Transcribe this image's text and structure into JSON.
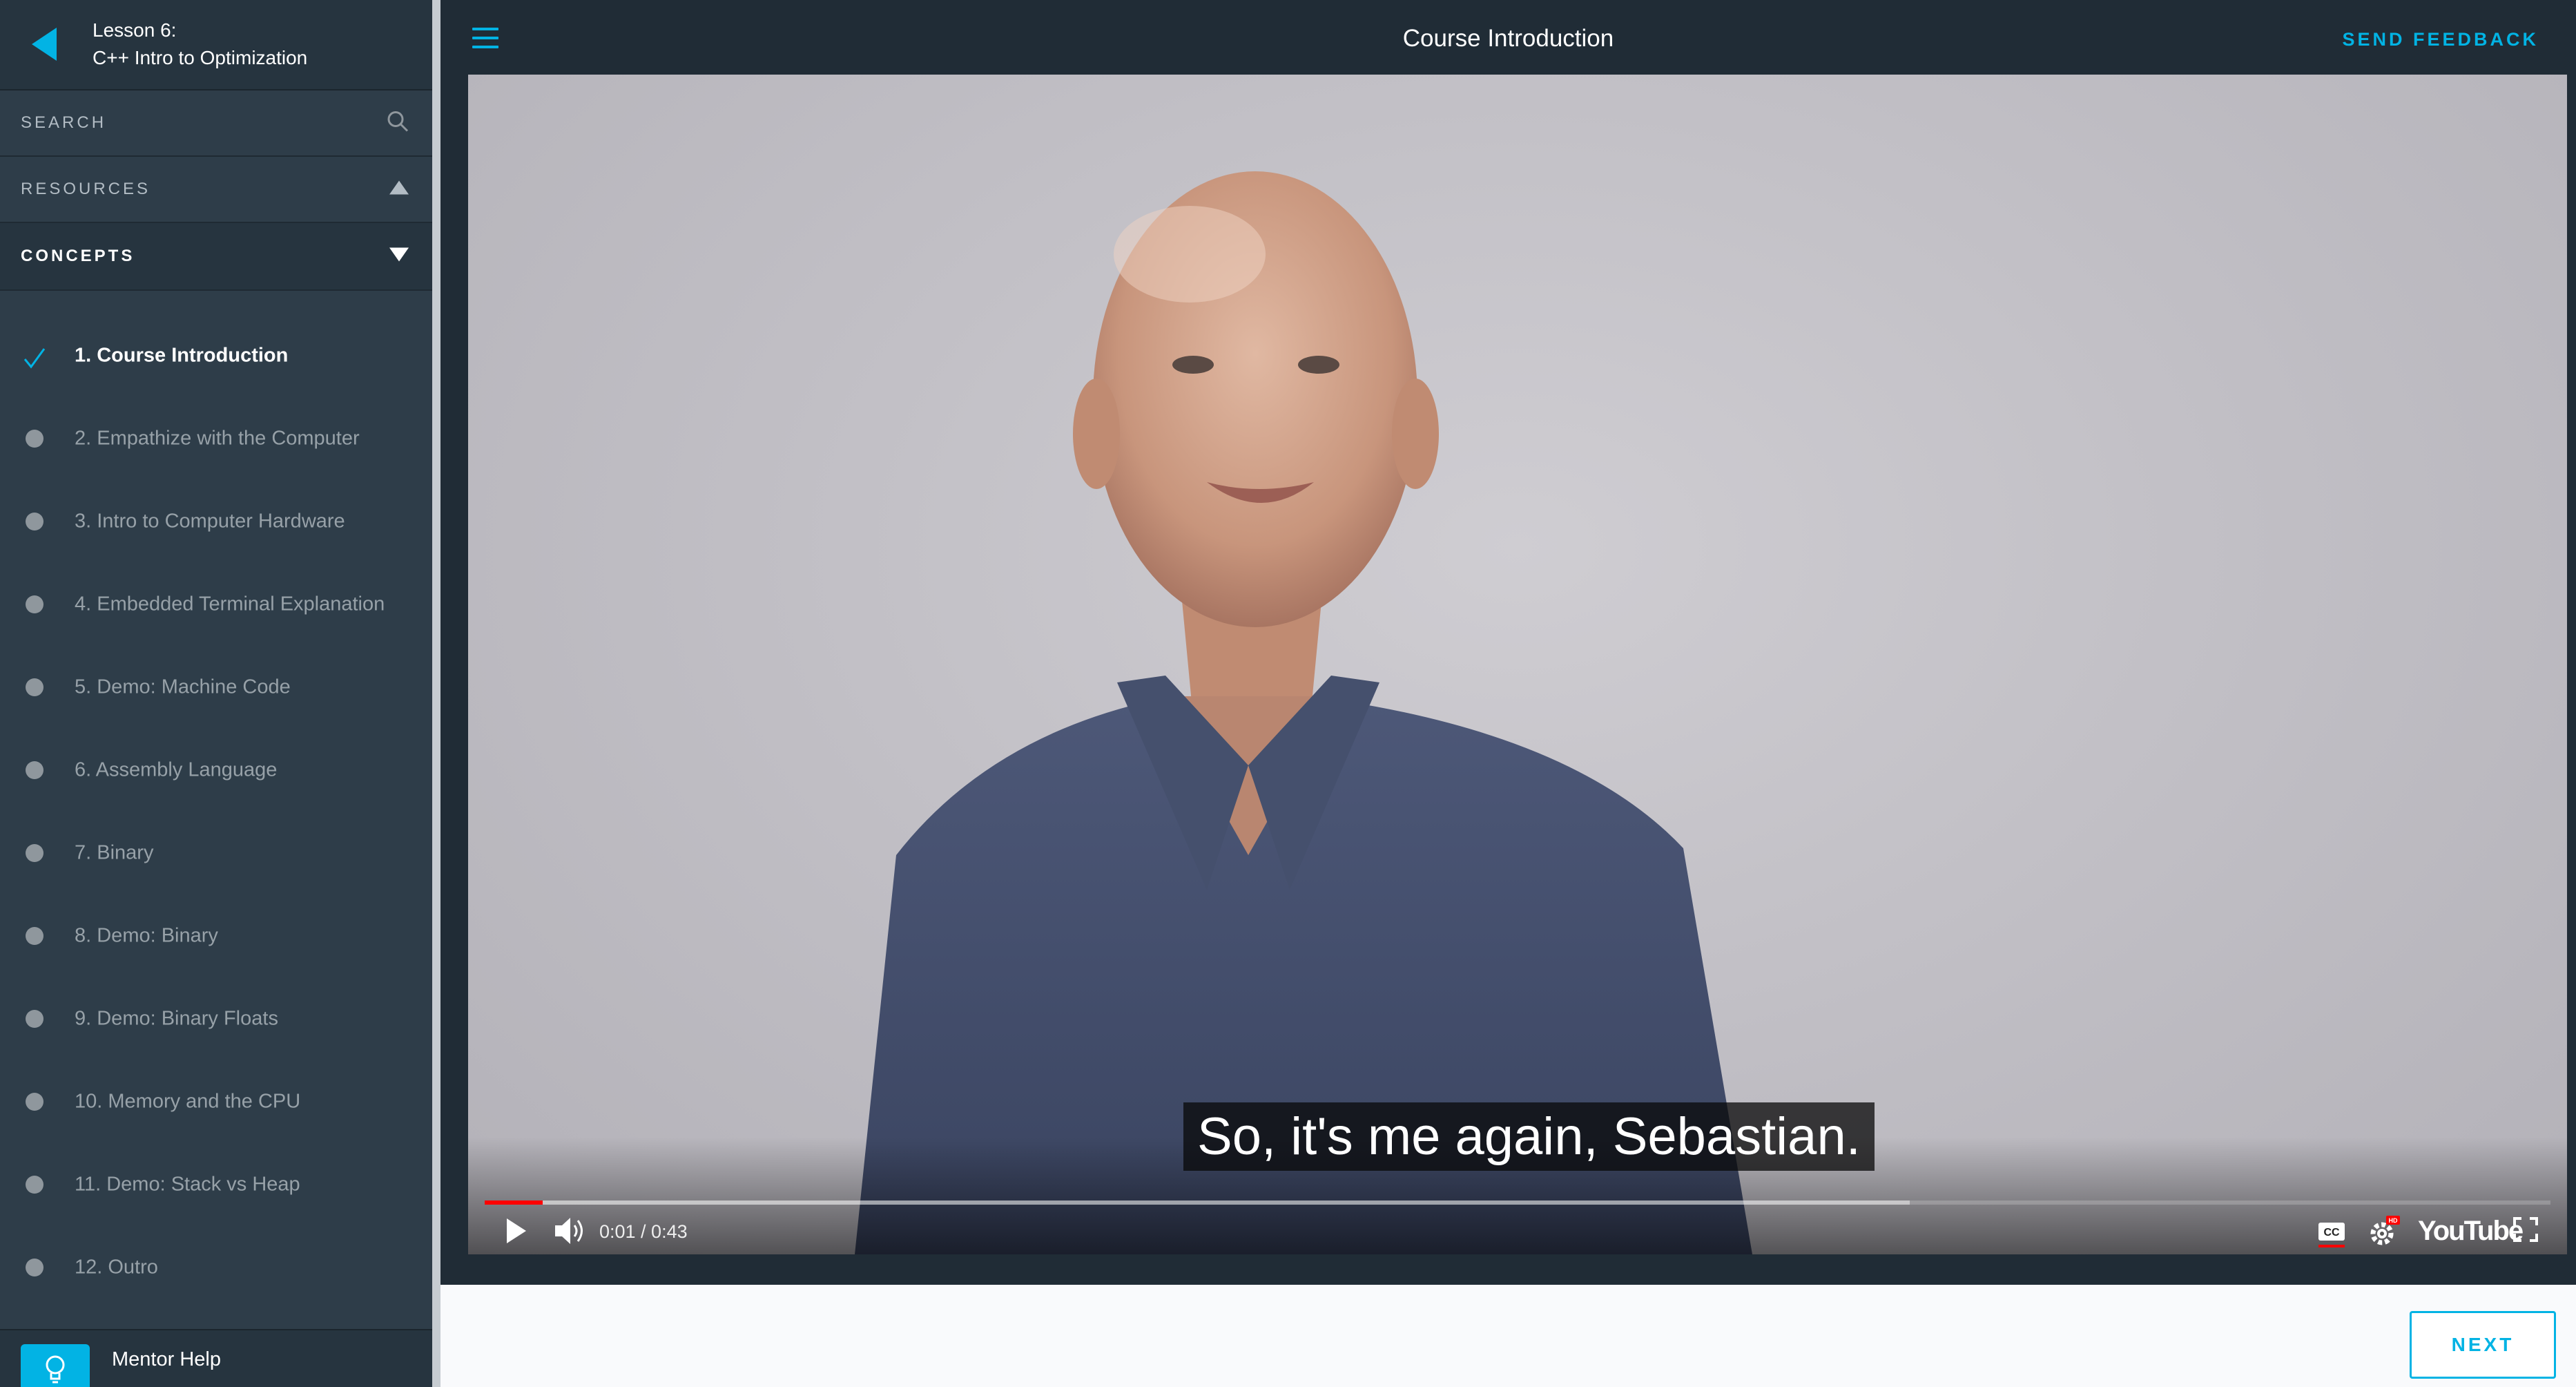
{
  "lesson": {
    "number": "Lesson 6:",
    "title": "C++ Intro to Optimization"
  },
  "sidebar": {
    "search_label": "SEARCH",
    "resources_label": "RESOURCES",
    "concepts_label": "CONCEPTS",
    "concepts": [
      {
        "label": "1. Course Introduction",
        "status": "completed"
      },
      {
        "label": "2. Empathize with the Computer",
        "status": "pending"
      },
      {
        "label": "3. Intro to Computer Hardware",
        "status": "pending"
      },
      {
        "label": "4. Embedded Terminal Explanation",
        "status": "pending"
      },
      {
        "label": "5. Demo: Machine Code",
        "status": "pending"
      },
      {
        "label": "6. Assembly Language",
        "status": "pending"
      },
      {
        "label": "7. Binary",
        "status": "pending"
      },
      {
        "label": "8. Demo: Binary",
        "status": "pending"
      },
      {
        "label": "9. Demo: Binary Floats",
        "status": "pending"
      },
      {
        "label": "10. Memory and the CPU",
        "status": "pending"
      },
      {
        "label": "11. Demo: Stack vs Heap",
        "status": "pending"
      },
      {
        "label": "12. Outro",
        "status": "pending"
      }
    ],
    "mentor_label": "Mentor Help"
  },
  "header": {
    "title": "Course Introduction",
    "feedback_label": "SEND FEEDBACK"
  },
  "video": {
    "caption": "So, it's me again, Sebastian.",
    "time": "0:01 / 0:43",
    "progress_fraction": 0.028,
    "buffered_fraction": 0.69,
    "platform_label": "YouTube",
    "hd_badge": "HD"
  },
  "footer": {
    "next_label": "NEXT"
  },
  "colors": {
    "accent": "#02b3e4",
    "sidebar_bg": "#2e3d49",
    "progress": "#ff0000"
  }
}
